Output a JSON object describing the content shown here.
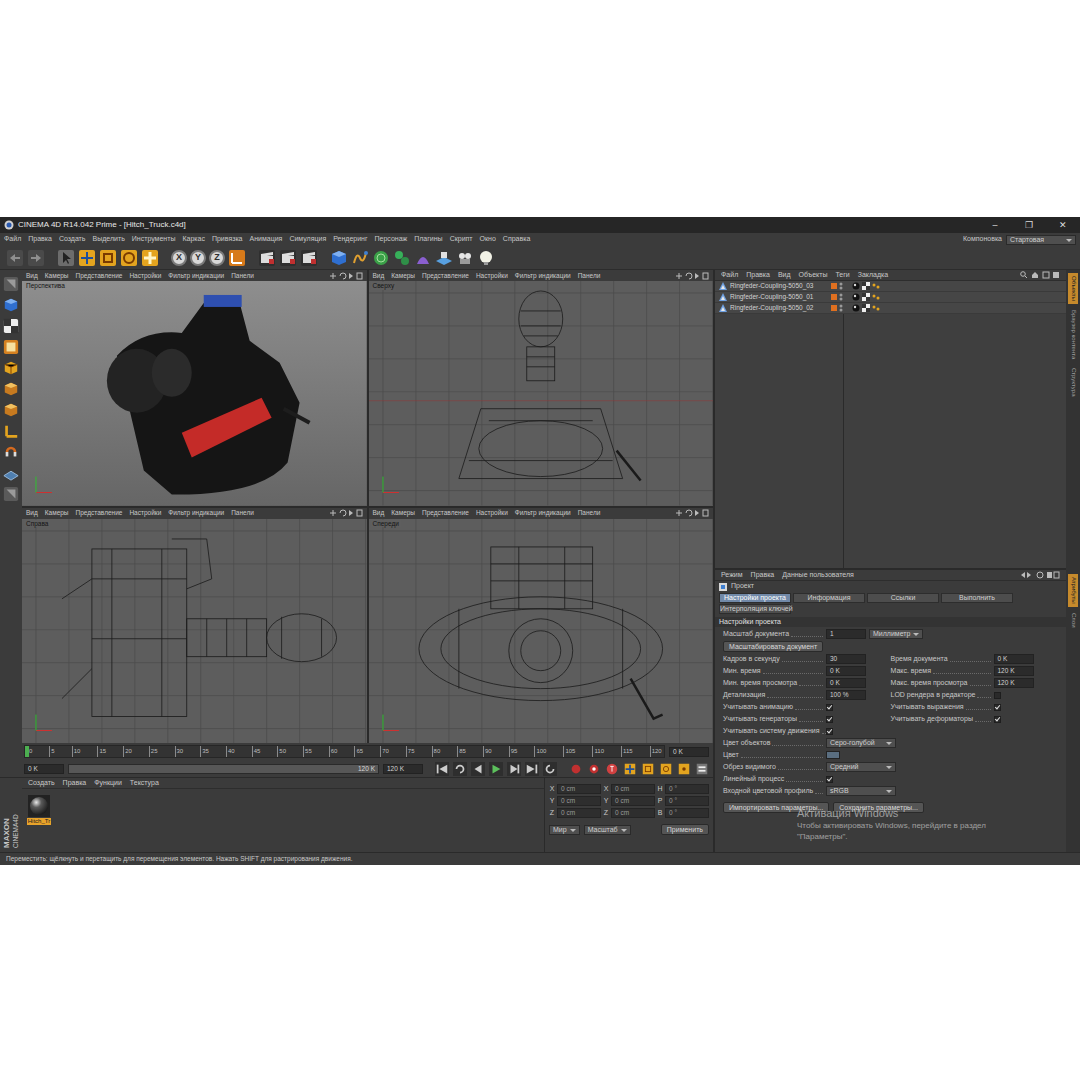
{
  "window": {
    "title": "CINEMA 4D R14.042 Prime - [Hitch_Truck.c4d]",
    "controls": [
      "–",
      "❐",
      "✕"
    ]
  },
  "menu": [
    "Файл",
    "Правка",
    "Создать",
    "Выделить",
    "Инструменты",
    "Каркас",
    "Привязка",
    "Анимация",
    "Симуляция",
    "Рендеринг",
    "Персонаж",
    "Плагины",
    "Скрипт",
    "Окно",
    "Справка"
  ],
  "layout": {
    "label": "Компоновка",
    "value": "Стартовая"
  },
  "toolbar": {
    "axes": [
      "X",
      "Y",
      "Z"
    ]
  },
  "viewport_menu": [
    "Вид",
    "Камеры",
    "Представление",
    "Настройки",
    "Фильтр индикации",
    "Панели"
  ],
  "viewports": [
    {
      "label": "Перспектива",
      "kind": "shaded"
    },
    {
      "label": "Сверху",
      "kind": "top"
    },
    {
      "label": "Справа",
      "kind": "side"
    },
    {
      "label": "Спереди",
      "kind": "front"
    }
  ],
  "timeline": {
    "ticks": [
      "0",
      "5",
      "10",
      "15",
      "20",
      "25",
      "30",
      "35",
      "40",
      "45",
      "50",
      "55",
      "60",
      "65",
      "70",
      "75",
      "80",
      "85",
      "90",
      "95",
      "100",
      "105",
      "110",
      "115",
      "120"
    ],
    "frame": "0 K",
    "level": 0,
    "start": "0 K",
    "slider_end": "120 K",
    "end": "120 K"
  },
  "logo": {
    "brand": "MAXON",
    "product": "CINEMA4D"
  },
  "materials": {
    "menu": [
      "Создать",
      "Правка",
      "Функции",
      "Текстура"
    ],
    "items": [
      {
        "name": "Hitch_Tr",
        "selected": true
      }
    ]
  },
  "coords": {
    "rows": [
      [
        "X",
        "0 cm",
        "X",
        "0 cm",
        "H",
        "0 °"
      ],
      [
        "Y",
        "0 cm",
        "Y",
        "0 cm",
        "P",
        "0 °"
      ],
      [
        "Z",
        "0 cm",
        "Z",
        "0 cm",
        "B",
        "0 °"
      ]
    ],
    "mode": "Мир",
    "scale": "Масштаб",
    "apply": "Применить"
  },
  "objects": {
    "menu": [
      "Файл",
      "Правка",
      "Вид",
      "Объекты",
      "Теги",
      "Закладка"
    ],
    "items": [
      {
        "name": "Ringfeder-Coupling-5050_03",
        "selected": false
      },
      {
        "name": "Ringfeder-Coupling-5050_01",
        "selected": false
      },
      {
        "name": "Ringfeder-Coupling-5050_02",
        "selected": false
      }
    ]
  },
  "attributes": {
    "menu": [
      "Режим",
      "Правка",
      "Данные пользователя"
    ],
    "title": "Проект",
    "tabs": [
      {
        "label": "Настройки проекта",
        "selected": true
      },
      {
        "label": "Информация",
        "selected": false
      },
      {
        "label": "Ссылки",
        "selected": false
      },
      {
        "label": "Выполнить",
        "selected": false
      },
      {
        "label": "Интерполяция ключей",
        "selected": false
      }
    ],
    "section": "Настройки проекта",
    "rows": [
      [
        {
          "kind": "unit",
          "label": "Масштаб документа",
          "value": "1",
          "unit": "Миллиметр"
        }
      ],
      [
        {
          "kind": "button",
          "label": "Масштабировать документ"
        }
      ],
      [
        {
          "kind": "number",
          "label": "Кадров в секунду",
          "value": "30"
        },
        {
          "kind": "number",
          "label": "Время документа",
          "value": "0 K"
        }
      ],
      [
        {
          "kind": "number",
          "label": "Мин. время",
          "value": "0 K"
        },
        {
          "kind": "number",
          "label": "Макс. время",
          "value": "120 K"
        }
      ],
      [
        {
          "kind": "number",
          "label": "Мин. время просмотра",
          "value": "0 K"
        },
        {
          "kind": "number",
          "label": "Макс. время просмотра",
          "value": "120 K"
        }
      ],
      [
        {
          "kind": "number",
          "label": "Детализация",
          "value": "100 %"
        },
        {
          "kind": "check",
          "label": "LOD рендера в редакторе",
          "checked": false
        }
      ],
      [
        {
          "kind": "check",
          "label": "Учитывать анимацию",
          "checked": true
        },
        {
          "kind": "check",
          "label": "Учитывать выражения",
          "checked": true
        }
      ],
      [
        {
          "kind": "check",
          "label": "Учитывать генераторы",
          "checked": true
        },
        {
          "kind": "check",
          "label": "Учитывать деформаторы",
          "checked": true
        }
      ],
      [
        {
          "kind": "check",
          "label": "Учитывать систему движения",
          "checked": true
        }
      ],
      [
        {
          "kind": "dropdown",
          "label": "Цвет объектов",
          "value": "Серо-голубой"
        }
      ],
      [
        {
          "kind": "color",
          "label": "Цвет",
          "color": "#5a6e80"
        }
      ],
      [
        {
          "kind": "dropdown",
          "label": "Обрез видимого",
          "value": "Средний"
        }
      ],
      [
        {
          "kind": "check",
          "label": "Линейный процесс",
          "checked": true
        }
      ],
      [
        {
          "kind": "dropdown",
          "label": "Входной цветовой профиль",
          "value": "sRGB"
        }
      ]
    ],
    "buttons": [
      "Импортировать параметры...",
      "Сохранить параметры..."
    ]
  },
  "watermark": {
    "title": "Активация Windows",
    "lines": [
      "Чтобы активировать Windows, перейдите в раздел",
      "\"Параметры\"."
    ]
  },
  "strip": {
    "upper": [
      {
        "label": "Объекты",
        "selected": true
      },
      {
        "label": "Браузер контента",
        "selected": false
      },
      {
        "label": "Структура",
        "selected": false
      }
    ],
    "lower": [
      {
        "label": "Атрибуты",
        "selected": true
      },
      {
        "label": "Слои",
        "selected": false
      }
    ]
  },
  "status_bar": "Переместить: щёлкнуть и перетащить для перемещения элементов. Нажать SHIFT для растрирования движения."
}
